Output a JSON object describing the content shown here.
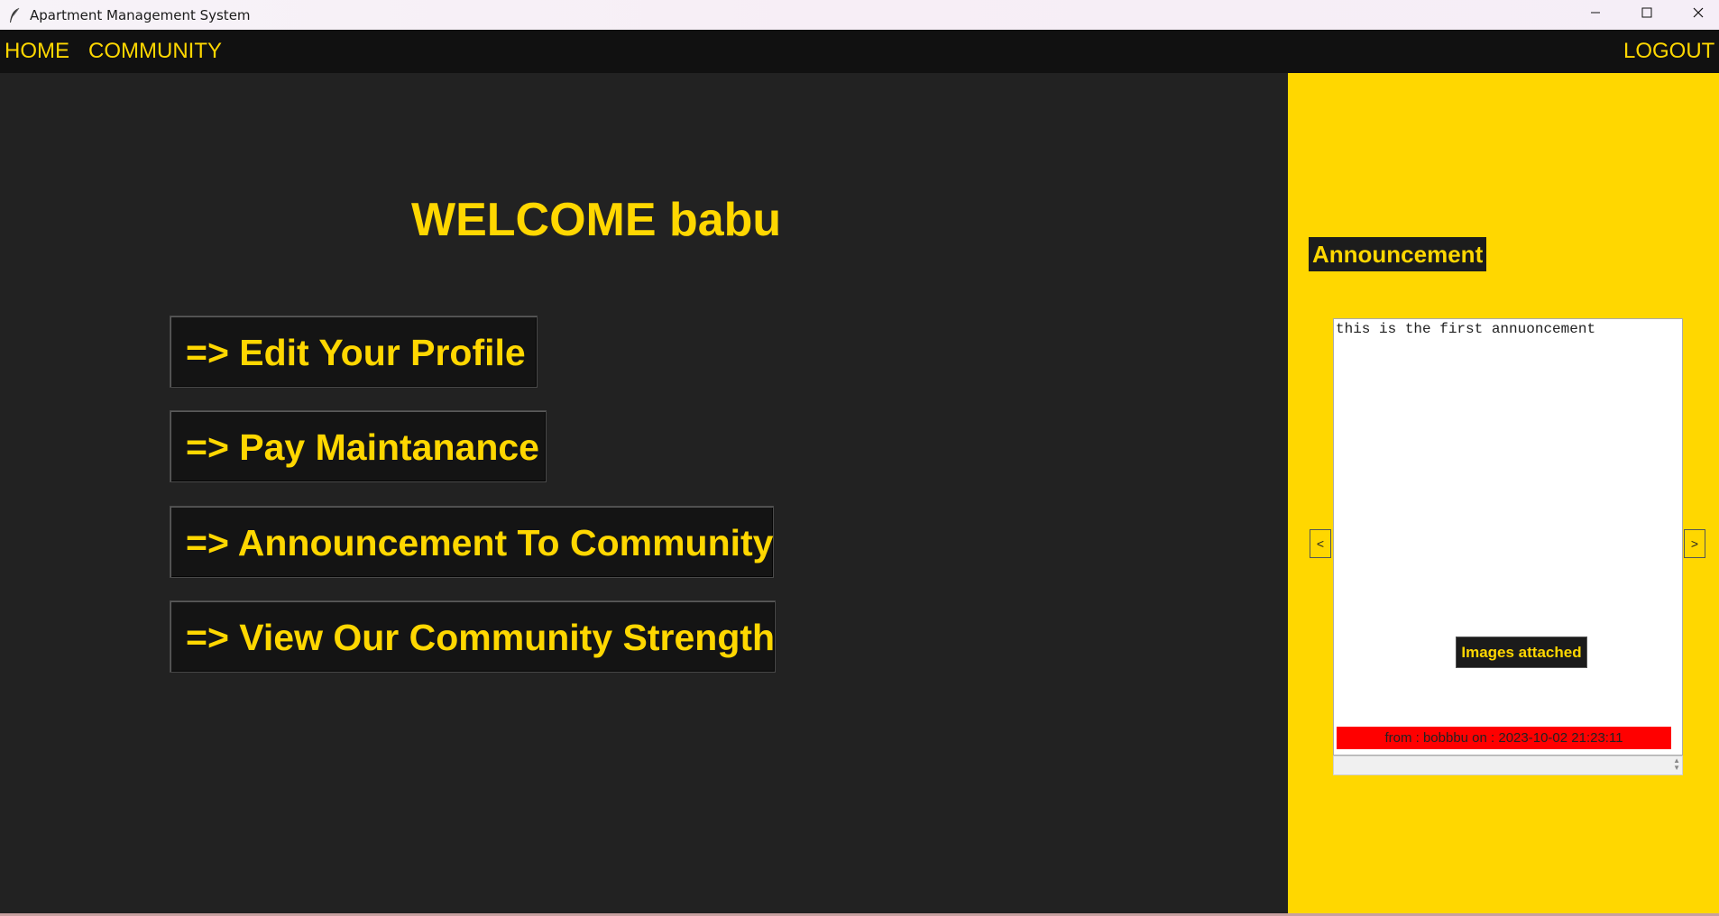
{
  "window": {
    "title": "Apartment Management System",
    "icons": {
      "app": "feather-icon",
      "minimize": "minimize-icon",
      "maximize": "maximize-icon",
      "close": "close-icon"
    }
  },
  "nav": {
    "home": "HOME",
    "community": "COMMUNITY",
    "logout": "LOGOUT"
  },
  "main": {
    "welcome": "WELCOME babu",
    "actions": [
      "=> Edit Your Profile",
      "=> Pay Maintanance",
      "=> Announcement To Community",
      "=> View Our Community Strength"
    ]
  },
  "announcement": {
    "title": "Announcement",
    "text": "this is the first annuoncement",
    "images_button": "Images attached",
    "from": "from : bobbbu on : 2023-10-02 21:23:11",
    "prev": "<",
    "next": ">"
  },
  "colors": {
    "accent": "#ffd700",
    "background": "#222222",
    "navbar": "#111111",
    "from_bar": "#ff0000"
  }
}
